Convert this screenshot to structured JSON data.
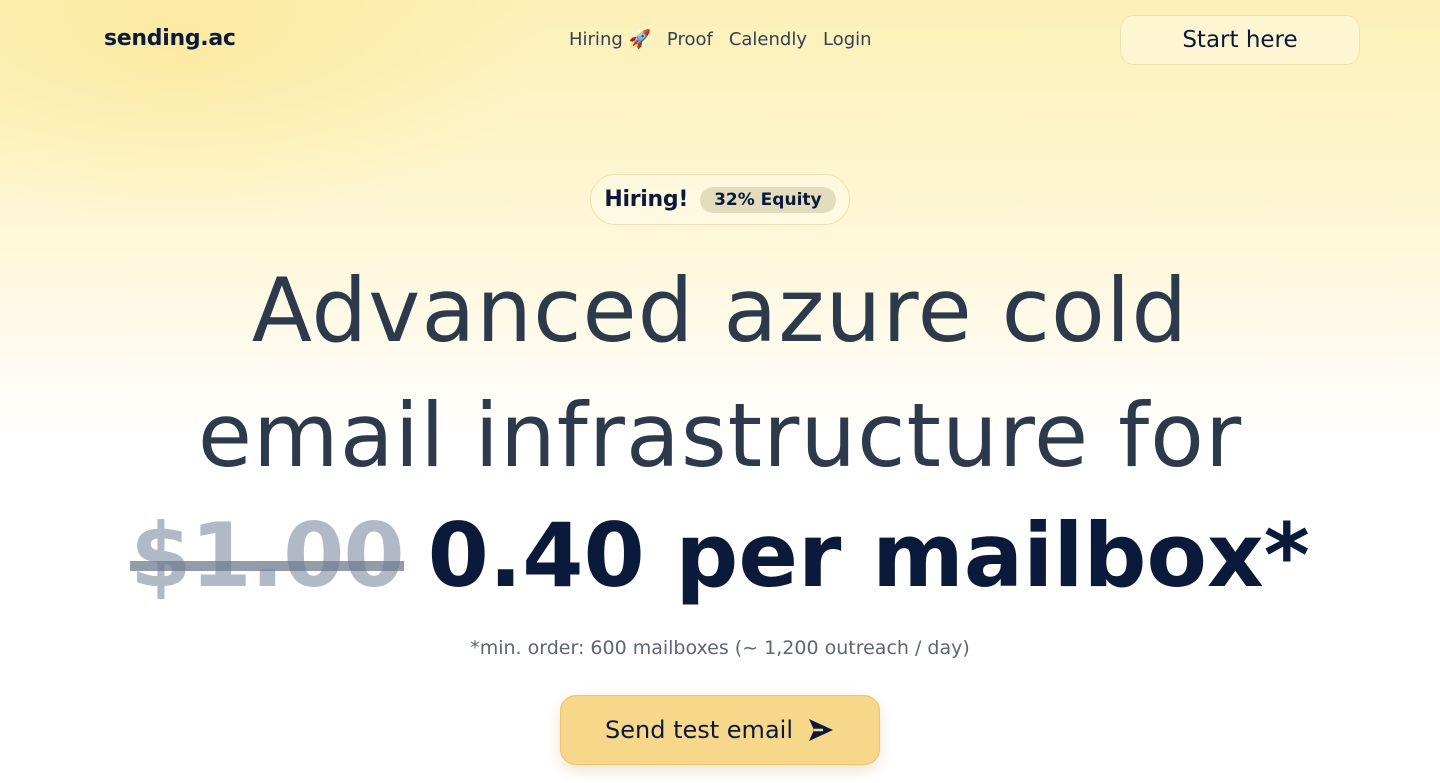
{
  "header": {
    "logo": "sending.ac",
    "nav": [
      {
        "label": "Hiring 🚀"
      },
      {
        "label": "Proof"
      },
      {
        "label": "Calendly"
      },
      {
        "label": "Login"
      }
    ],
    "start_label": "Start here"
  },
  "hero": {
    "badge_main": "Hiring!",
    "badge_pill": "32% Equity",
    "headline_line1": "Advanced azure cold",
    "headline_line2": "email infrastructure for",
    "old_price": "$1.00",
    "new_price": "0.40 per mailbox*",
    "note": "*min. order: 600 mailboxes (~ 1,200 outreach / day)",
    "cta_label": "Send test email",
    "cta_icon": "send-arrow-icon"
  },
  "colors": {
    "accent": "#f7d78a",
    "ink": "#0b1a3a",
    "headline": "#2d3a4b",
    "strike": "#b1b8c6"
  }
}
